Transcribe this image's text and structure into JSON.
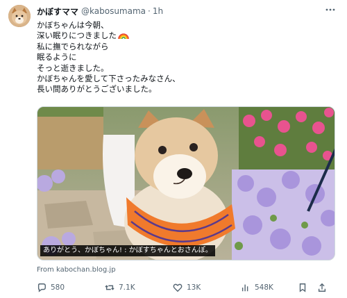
{
  "author": {
    "display_name": "かぼすママ",
    "handle": "@kabosumama",
    "separator": "·",
    "time": "1h"
  },
  "tweet_lines": [
    "かぼちゃんは今朝、",
    "深い眠りにつきました",
    "私に撫でられながら",
    "眠るように",
    "そっと逝きました。",
    "かぼちゃんを愛して下さったみなさん、",
    "長い間ありがとうございました。"
  ],
  "media": {
    "caption": "ありがとう、かぼちゃん! : かぼすちゃんとおさんぽ。"
  },
  "source_text": "From kabochan.blog.jp",
  "actions": {
    "replies": "580",
    "reposts": "7.1K",
    "likes": "13K",
    "views": "548K"
  },
  "icons": {
    "avatar": "shiba-avatar-icon",
    "more": "more-dots-icon",
    "reply": "reply-icon",
    "repost": "repost-icon",
    "like": "heart-icon",
    "views": "views-bar-icon",
    "bookmark": "bookmark-icon",
    "share": "share-icon",
    "rainbow": "rainbow-emoji-icon"
  },
  "colors": {
    "text": "#0f1419",
    "muted": "#536471",
    "border": "#cfd9de",
    "harness": "#f07a2c"
  }
}
